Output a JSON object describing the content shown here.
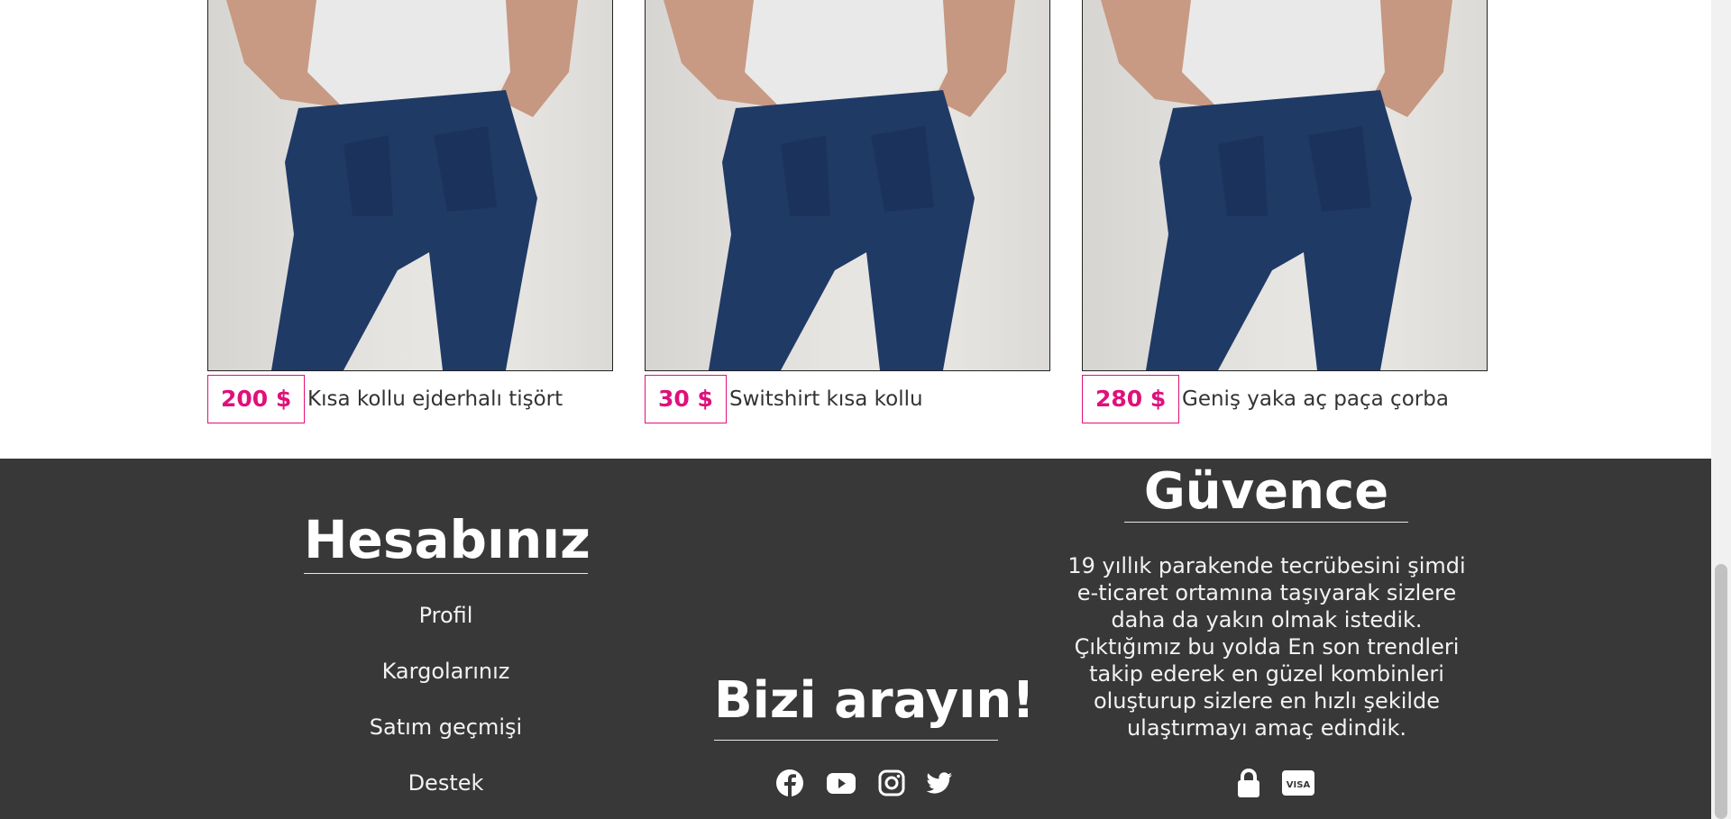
{
  "products": [
    {
      "price": "200 $",
      "name": "Kısa kollu ejderhalı tişört",
      "image": "woman-jeans-back-photo"
    },
    {
      "price": "30 $",
      "name": "Switshirt kısa kollu",
      "image": "woman-jeans-back-photo"
    },
    {
      "price": "280 $",
      "name": "Geniş yaka aç paça çorba",
      "image": "woman-jeans-back-photo"
    }
  ],
  "footer": {
    "account": {
      "title": "Hesabınız",
      "links": [
        "Profil",
        "Kargolarınız",
        "Satım geçmişi",
        "Destek"
      ]
    },
    "contact": {
      "title": "Bizi arayın!",
      "icons": [
        "facebook-icon",
        "youtube-icon",
        "instagram-icon",
        "twitter-icon"
      ]
    },
    "trust": {
      "title": "Güvence",
      "text": "19 yıllık parakende tecrübesini şimdi e-ticaret ortamına taşıyarak sizlere daha da yakın olmak istedik. Çıktığımız bu yolda En son trendleri takip ederek en güzel kombinleri oluşturup sizlere en hızlı şekilde ulaştırmayı amaç edindik.",
      "icons": [
        "lock-icon",
        "visa-icon"
      ]
    }
  },
  "colors": {
    "accent": "#e0107a",
    "footer_bg": "#383838",
    "text": "#333333"
  }
}
